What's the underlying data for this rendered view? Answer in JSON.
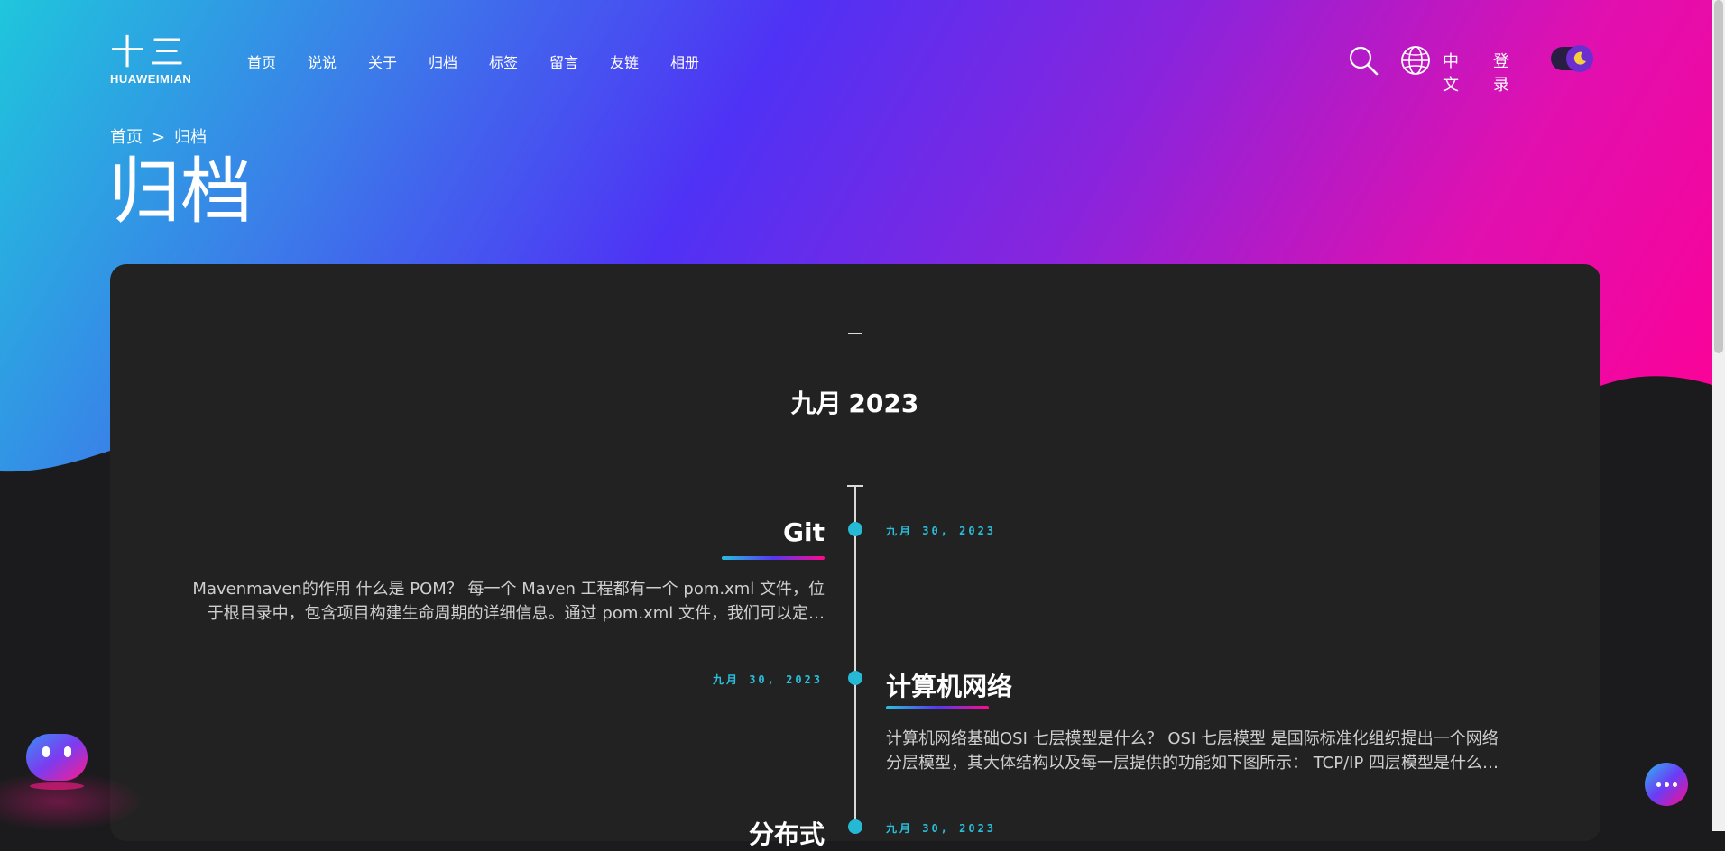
{
  "brand": {
    "logo_cn": "十三",
    "logo_en": "HUAWEIMIAN"
  },
  "nav": [
    "首页",
    "说说",
    "关于",
    "归档",
    "标签",
    "留言",
    "友链",
    "相册"
  ],
  "toolbar": {
    "language": "中文",
    "login": "登录",
    "theme_icon": "moon-icon",
    "search_icon": "search-icon",
    "globe_icon": "globe-icon"
  },
  "breadcrumb": {
    "home": "首页",
    "separator": ">",
    "current": "归档"
  },
  "page_title": "归档",
  "archive": {
    "dash": "–",
    "month_cn": "九月",
    "month_year": "2023",
    "posts": [
      {
        "date": "九月 30, 2023",
        "title": "Git",
        "excerpt_line1": "Mavenmaven的作用 什么是 POM？ 每一个 Maven 工程都有一个 pom.xml 文件，位",
        "excerpt_line2": "于根目录中，包含项目构建生命周期的详细信息。通过 pom.xml 文件，我们可以定…"
      },
      {
        "date": "九月 30, 2023",
        "title": "计算机网络",
        "excerpt_line1": "计算机网络基础OSI 七层模型是什么？ OSI 七层模型 是国际标准化组织提出一个网络",
        "excerpt_line2": "分层模型，其大体结构以及每一层提供的功能如下图所示： TCP/IP 四层模型是什么…"
      },
      {
        "date": "九月 30, 2023",
        "title": "分布式"
      }
    ]
  },
  "colors": {
    "accent": "#26b9d6",
    "pink": "#ff0094",
    "violet": "#4f32f5",
    "card": "#222222",
    "page": "#1b1b1d"
  }
}
